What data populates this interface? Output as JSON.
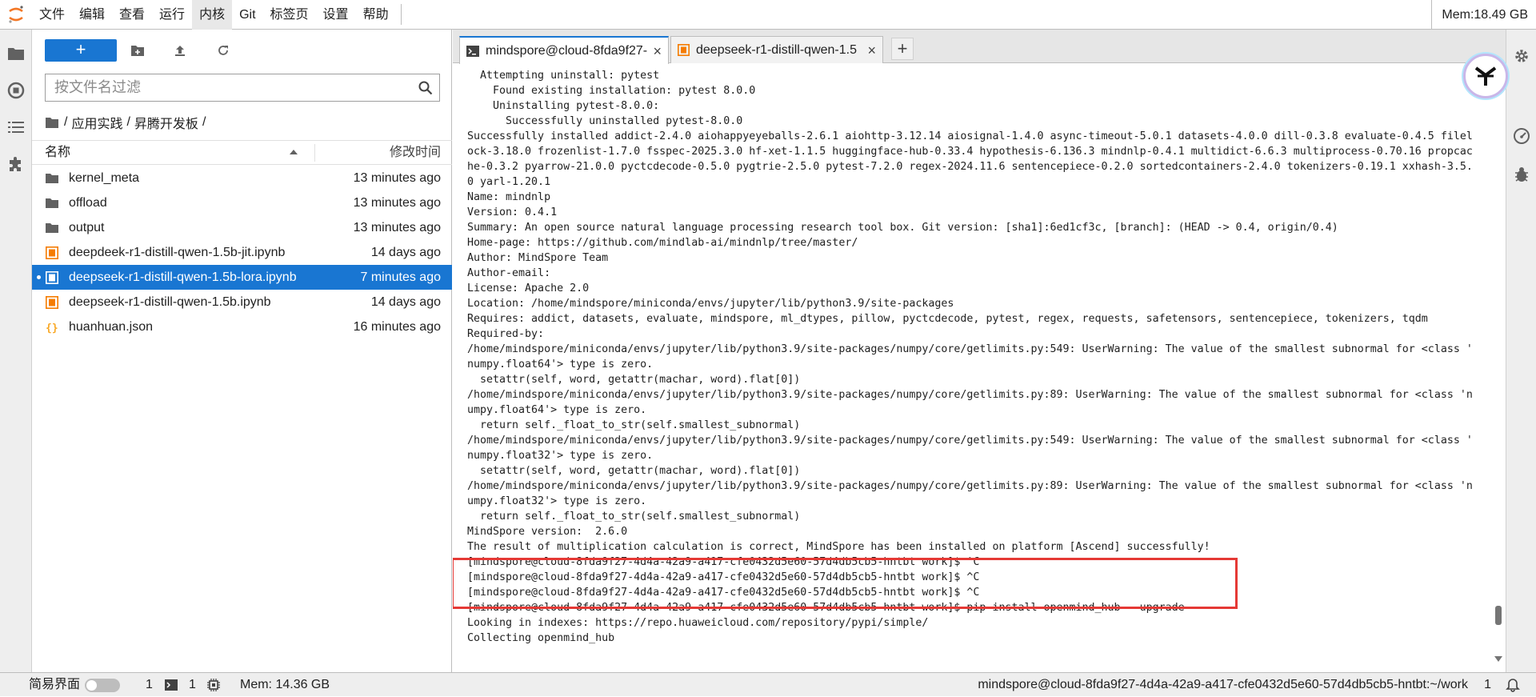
{
  "menubar": {
    "items": [
      "文件",
      "编辑",
      "查看",
      "运行",
      "内核",
      "Git",
      "标签页",
      "设置",
      "帮助"
    ],
    "active_index": 4,
    "memory": "Mem:18.49 GB"
  },
  "filebrowser": {
    "new_label": "+",
    "filter_placeholder": "按文件名过滤",
    "breadcrumb": [
      "/",
      "应用实践",
      "/",
      "昇腾开发板",
      "/"
    ],
    "col_name": "名称",
    "col_time": "修改时间",
    "files": [
      {
        "name": "kernel_meta",
        "time": "13 minutes ago",
        "type": "folder"
      },
      {
        "name": "offload",
        "time": "13 minutes ago",
        "type": "folder"
      },
      {
        "name": "output",
        "time": "13 minutes ago",
        "type": "folder"
      },
      {
        "name": "deepdeek-r1-distill-qwen-1.5b-jit.ipynb",
        "time": "14 days ago",
        "type": "notebook"
      },
      {
        "name": "deepseek-r1-distill-qwen-1.5b-lora.ipynb",
        "time": "7 minutes ago",
        "type": "notebook",
        "selected": true
      },
      {
        "name": "deepseek-r1-distill-qwen-1.5b.ipynb",
        "time": "14 days ago",
        "type": "notebook"
      },
      {
        "name": "huanhuan.json",
        "time": "16 minutes ago",
        "type": "json"
      }
    ]
  },
  "tabs": [
    {
      "label": "mindspore@cloud-8fda9f27-",
      "icon": "terminal-icon",
      "active": true
    },
    {
      "label": "deepseek-r1-distill-qwen-1.5",
      "icon": "notebook-icon",
      "active": false
    }
  ],
  "terminal": {
    "lines": [
      "  Attempting uninstall: pytest",
      "    Found existing installation: pytest 8.0.0",
      "    Uninstalling pytest-8.0.0:",
      "      Successfully uninstalled pytest-8.0.0",
      "Successfully installed addict-2.4.0 aiohappyeyeballs-2.6.1 aiohttp-3.12.14 aiosignal-1.4.0 async-timeout-5.0.1 datasets-4.0.0 dill-0.3.8 evaluate-0.4.5 filel",
      "ock-3.18.0 frozenlist-1.7.0 fsspec-2025.3.0 hf-xet-1.1.5 huggingface-hub-0.33.4 hypothesis-6.136.3 mindnlp-0.4.1 multidict-6.6.3 multiprocess-0.70.16 propcac",
      "he-0.3.2 pyarrow-21.0.0 pyctcdecode-0.5.0 pygtrie-2.5.0 pytest-7.2.0 regex-2024.11.6 sentencepiece-0.2.0 sortedcontainers-2.4.0 tokenizers-0.19.1 xxhash-3.5.",
      "0 yarl-1.20.1",
      "Name: mindnlp",
      "Version: 0.4.1",
      "Summary: An open source natural language processing research tool box. Git version: [sha1]:6ed1cf3c, [branch]: (HEAD -> 0.4, origin/0.4)",
      "Home-page: https://github.com/mindlab-ai/mindnlp/tree/master/",
      "Author: MindSpore Team",
      "Author-email:",
      "License: Apache 2.0",
      "Location: /home/mindspore/miniconda/envs/jupyter/lib/python3.9/site-packages",
      "Requires: addict, datasets, evaluate, mindspore, ml_dtypes, pillow, pyctcdecode, pytest, regex, requests, safetensors, sentencepiece, tokenizers, tqdm",
      "Required-by:",
      "/home/mindspore/miniconda/envs/jupyter/lib/python3.9/site-packages/numpy/core/getlimits.py:549: UserWarning: The value of the smallest subnormal for <class '",
      "numpy.float64'> type is zero.",
      "  setattr(self, word, getattr(machar, word).flat[0])",
      "/home/mindspore/miniconda/envs/jupyter/lib/python3.9/site-packages/numpy/core/getlimits.py:89: UserWarning: The value of the smallest subnormal for <class 'n",
      "umpy.float64'> type is zero.",
      "  return self._float_to_str(self.smallest_subnormal)",
      "/home/mindspore/miniconda/envs/jupyter/lib/python3.9/site-packages/numpy/core/getlimits.py:549: UserWarning: The value of the smallest subnormal for <class '",
      "numpy.float32'> type is zero.",
      "  setattr(self, word, getattr(machar, word).flat[0])",
      "/home/mindspore/miniconda/envs/jupyter/lib/python3.9/site-packages/numpy/core/getlimits.py:89: UserWarning: The value of the smallest subnormal for <class 'n",
      "umpy.float32'> type is zero.",
      "  return self._float_to_str(self.smallest_subnormal)",
      "MindSpore version:  2.6.0",
      "The result of multiplication calculation is correct, MindSpore has been installed on platform [Ascend] successfully!",
      "[mindspore@cloud-8fda9f27-4d4a-42a9-a417-cfe0432d5e60-57d4db5cb5-hntbt work]$ ^C",
      "[mindspore@cloud-8fda9f27-4d4a-42a9-a417-cfe0432d5e60-57d4db5cb5-hntbt work]$ ^C",
      "[mindspore@cloud-8fda9f27-4d4a-42a9-a417-cfe0432d5e60-57d4db5cb5-hntbt work]$ ^C",
      "[mindspore@cloud-8fda9f27-4d4a-42a9-a417-cfe0432d5e60-57d4db5cb5-hntbt work]$ pip install openmind_hub --upgrade",
      "Looking in indexes: https://repo.huaweicloud.com/repository/pypi/simple/",
      "Collecting openmind_hub"
    ]
  },
  "statusbar": {
    "simple_mode": "简易界面",
    "terminals_count": "1",
    "kernels_count": "1",
    "memory": "Mem: 14.36 GB",
    "path": "mindspore@cloud-8fda9f27-4d4a-42a9-a417-cfe0432d5e60-57d4db5cb5-hntbt:~/work",
    "notifications": "1"
  },
  "colors": {
    "accent": "#1976d2",
    "highlight_box": "#e53935",
    "notebook_icon": "#f57c00",
    "json_icon": "#f9a825"
  }
}
